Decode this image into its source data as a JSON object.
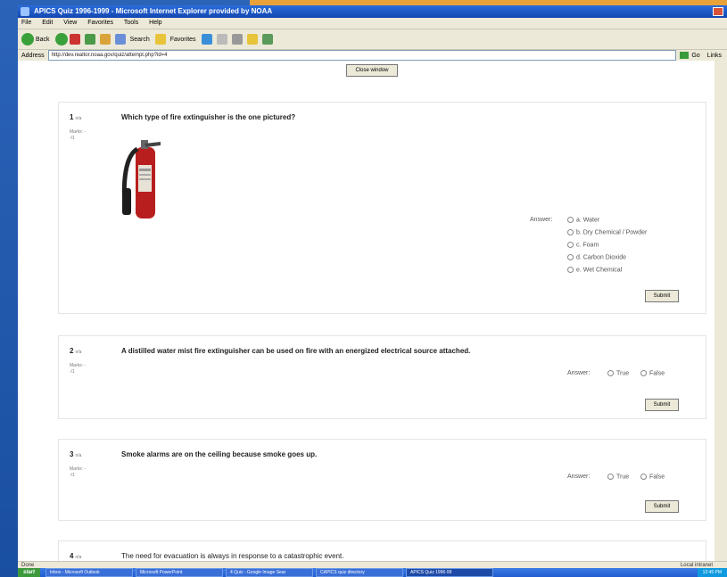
{
  "window": {
    "title": "APICS Quiz 1996-1999 - Microsoft Internet Explorer provided by NOAA",
    "menu": [
      "File",
      "Edit",
      "View",
      "Favorites",
      "Tools",
      "Help"
    ],
    "toolbar": {
      "back": "Back",
      "search": "Search",
      "favorites": "Favorites"
    },
    "address_label": "Address",
    "address_value": "http://dev.realtor.noaa.gov/quiz/attempt.php?id=4",
    "go_label": "Go",
    "links_label": "Links"
  },
  "page": {
    "top_button": "Close window",
    "questions": [
      {
        "num": "1",
        "num_suffix": "n/a",
        "marks": "Marks: --/1",
        "text": "Which type of fire extinguisher is the one pictured?",
        "answer_label": "Answer:",
        "options": [
          "a. Water",
          "b. Dry Chemical / Powder",
          "c. Foam",
          "d. Carbon Dioxide",
          "e. Wet Chemical"
        ],
        "submit": "Submit"
      },
      {
        "num": "2",
        "num_suffix": "n/a",
        "marks": "Marks: --/1",
        "text": "A distilled water mist fire extinguisher can be used on fire with an energized electrical source attached.",
        "answer_label": "Answer:",
        "options": [
          "True",
          "False"
        ],
        "submit": "Submit"
      },
      {
        "num": "3",
        "num_suffix": "n/a",
        "marks": "Marks: --/1",
        "text": "Smoke alarms are on the ceiling because smoke goes up.",
        "answer_label": "Answer:",
        "options": [
          "True",
          "False"
        ],
        "submit": "Submit"
      },
      {
        "num": "4",
        "num_suffix": "n/a",
        "text": "The need for evacuation is always in response to a catastrophic event."
      }
    ]
  },
  "status": {
    "left": "Done",
    "right": "Local intranet"
  },
  "taskbar": {
    "start": "start",
    "tasks": [
      "Inbox - Microsoft Outlook",
      "Microsoft PowerPoint",
      "4 Quiz - Google Image Sear",
      "CAPICS quiz directory",
      "APICS Quiz 1996-99"
    ],
    "tray": "12:45 PM"
  },
  "colors": {
    "titlebar": "#1447b3",
    "desktop": "#1f5ab0",
    "accent_top": "#e9a23a"
  }
}
